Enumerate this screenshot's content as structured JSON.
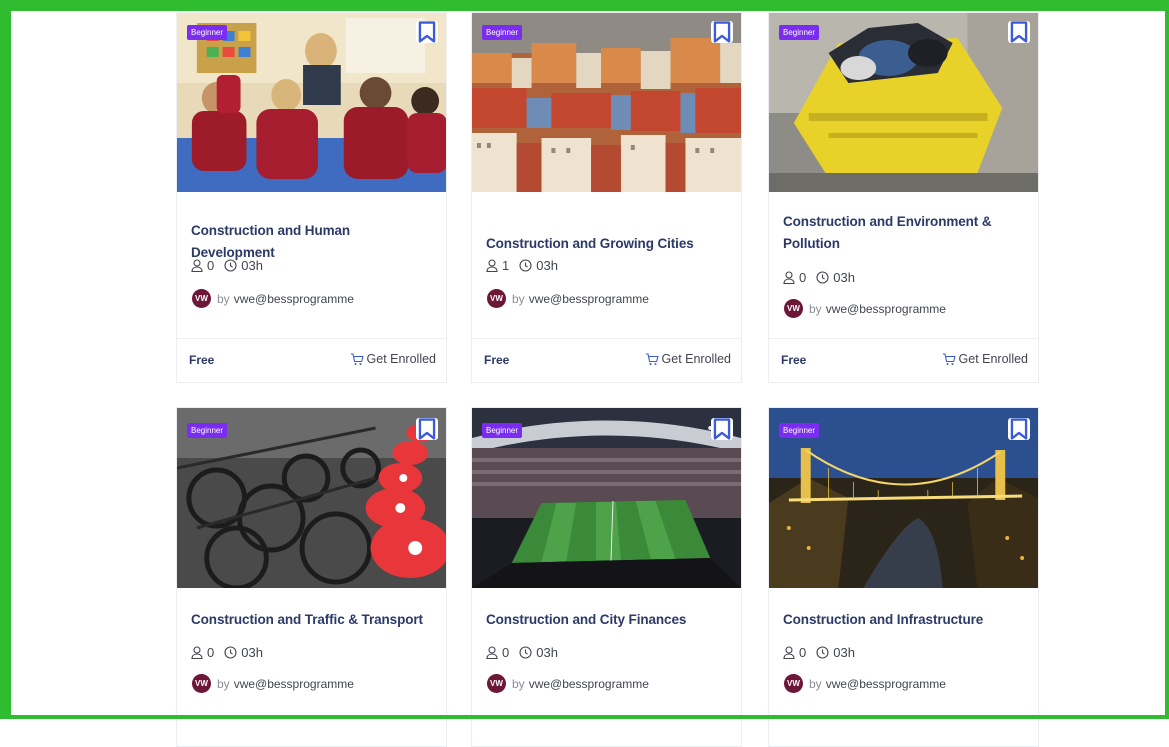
{
  "courses": [
    {
      "level": "Beginner",
      "title": "Construction and Human Development",
      "students": "0",
      "duration": "03h",
      "avatar": "VW",
      "by": "by",
      "author": "vwe@bessprogramme",
      "price": "Free",
      "enroll": "Get Enrolled"
    },
    {
      "level": "Beginner",
      "title": "Construction and Growing Cities",
      "students": "1",
      "duration": "03h",
      "avatar": "VW",
      "by": "by",
      "author": "vwe@bessprogramme",
      "price": "Free",
      "enroll": "Get Enrolled"
    },
    {
      "level": "Beginner",
      "title": "Construction and Environment & Pollution",
      "students": "0",
      "duration": "03h",
      "avatar": "VW",
      "by": "by",
      "author": "vwe@bessprogramme",
      "price": "Free",
      "enroll": "Get Enrolled"
    },
    {
      "level": "Beginner",
      "title": "Construction and Traffic & Transport",
      "students": "0",
      "duration": "03h",
      "avatar": "VW",
      "by": "by",
      "author": "vwe@bessprogramme"
    },
    {
      "level": "Beginner",
      "title": "Construction and City Finances",
      "students": "0",
      "duration": "03h",
      "avatar": "VW",
      "by": "by",
      "author": "vwe@bessprogramme"
    },
    {
      "level": "Beginner",
      "title": "Construction and Infrastructure",
      "students": "0",
      "duration": "03h",
      "avatar": "VW",
      "by": "by",
      "author": "vwe@bessprogramme"
    }
  ],
  "colors": {
    "accent": "#7a2cf0",
    "frame": "#2fbd2f",
    "title": "#2b3a67",
    "avatar": "#6d1737",
    "bookmark": "#3b5bd9"
  },
  "icons": {
    "bookmark": "bookmark-icon",
    "students": "user-icon",
    "duration": "clock-icon",
    "cart": "cart-icon"
  }
}
